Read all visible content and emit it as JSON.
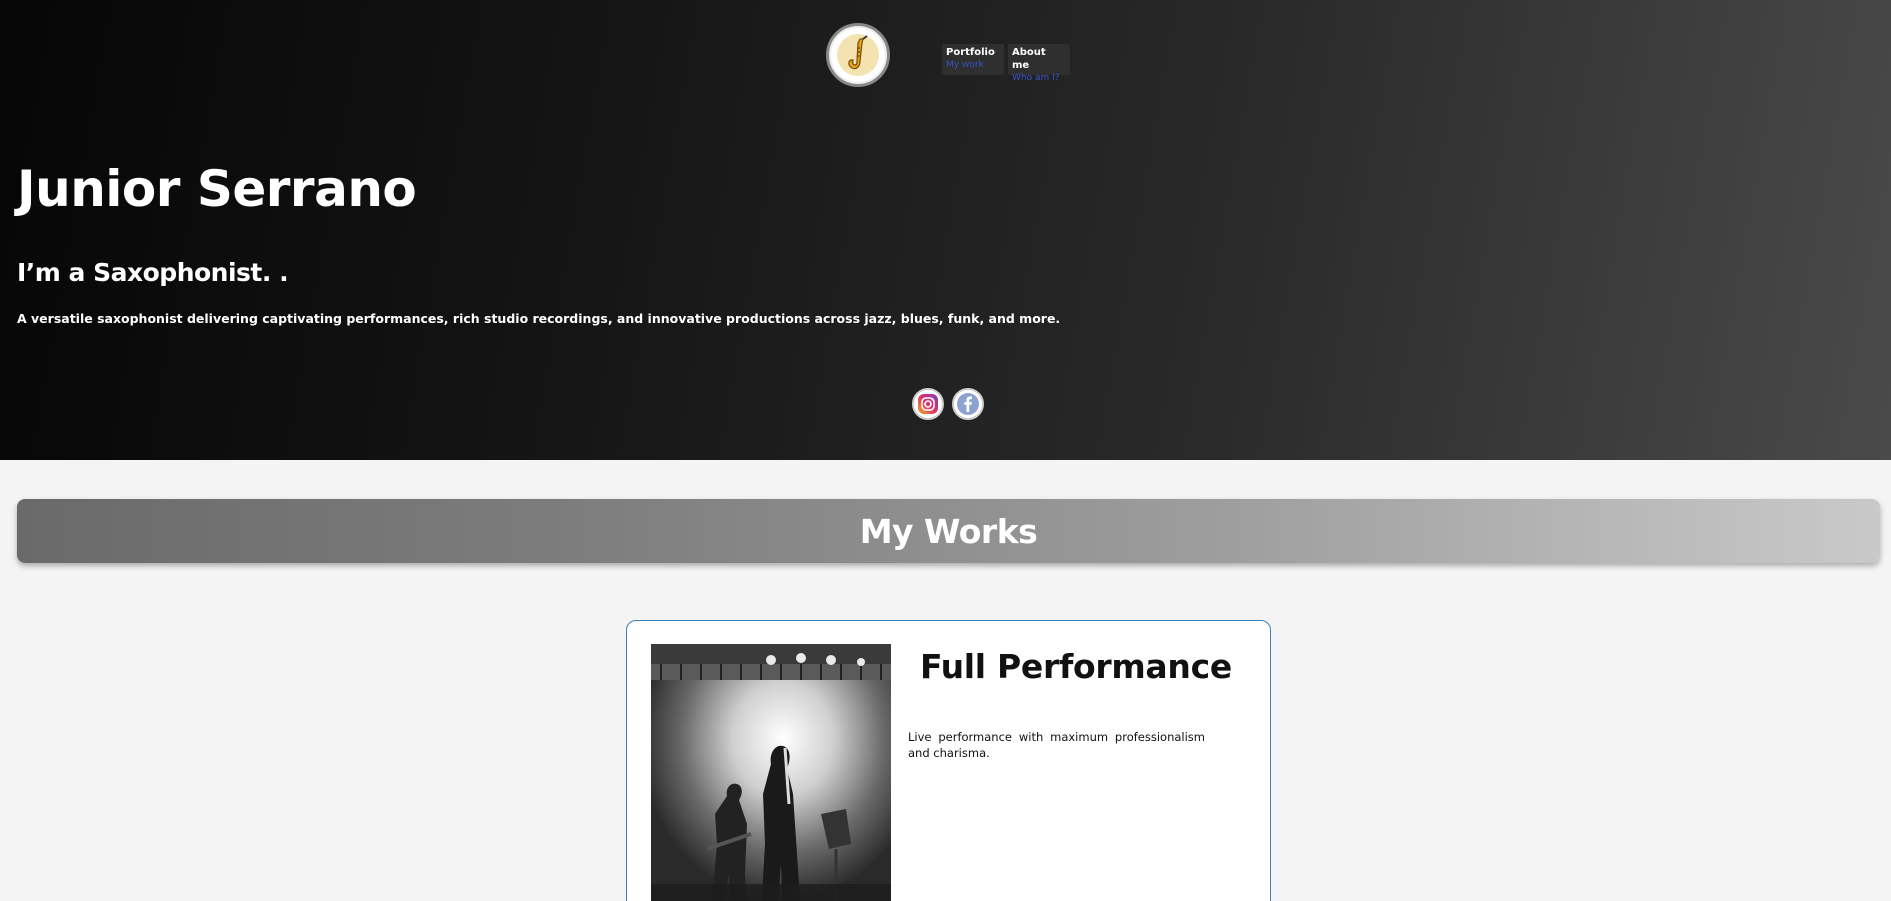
{
  "nav": {
    "items": [
      {
        "title": "Portfolio",
        "sub": "My work"
      },
      {
        "title": "About me",
        "sub": "Who am I?"
      }
    ]
  },
  "hero": {
    "name": "Junior Serrano",
    "role": "I’m a Saxophonist. .",
    "description": "A versatile saxophonist delivering captivating performances, rich studio recordings, and innovative productions across jazz, blues, funk, and more."
  },
  "social": {
    "icons": [
      "instagram-icon",
      "facebook-icon"
    ]
  },
  "works": {
    "heading": "My Works",
    "card": {
      "title": "Full Performance",
      "text": "Live performance with maximum professionalism and charisma."
    }
  },
  "colors": {
    "nav_sub": "#3a52c8",
    "card_border": "#3a7fb8",
    "sax_gold": "#e8a318"
  }
}
